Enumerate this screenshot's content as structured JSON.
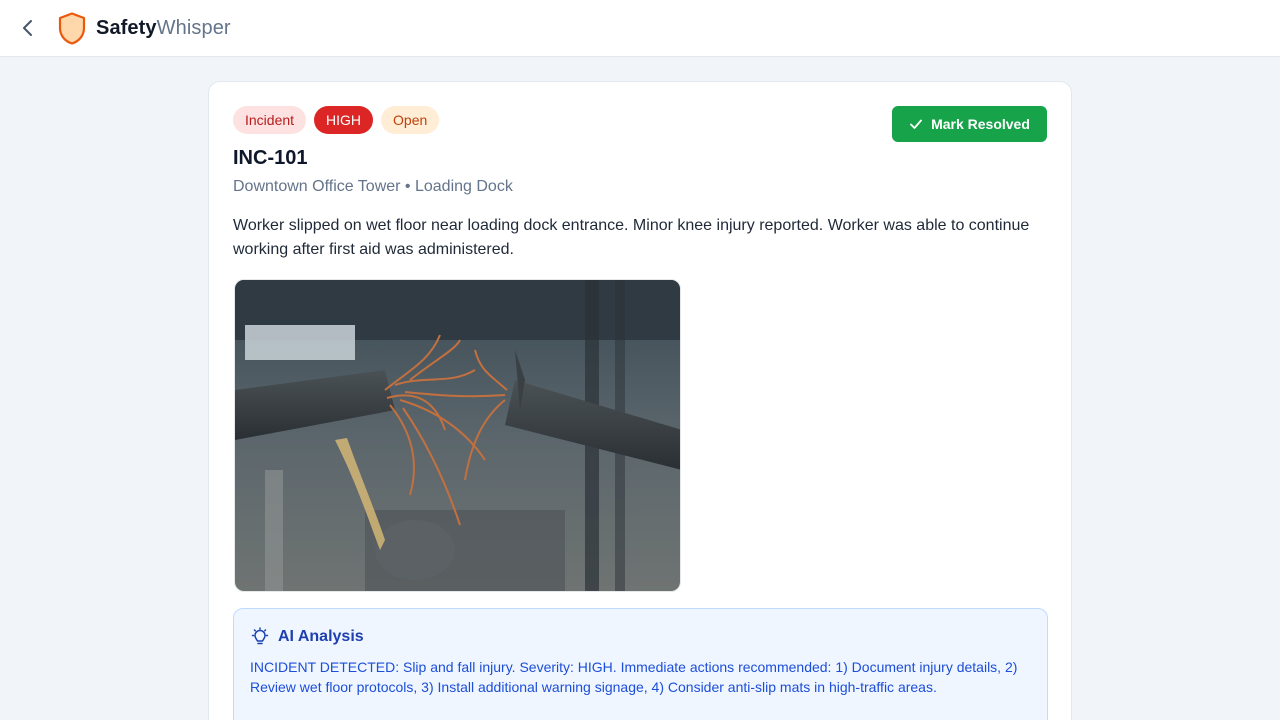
{
  "app": {
    "brand_bold": "Safety",
    "brand_light": "Whisper",
    "colors": {
      "brand_orange": "#ea580c",
      "success": "#16a34a",
      "danger": "#dc2626"
    }
  },
  "header": {
    "back_icon": "chevron-left-icon",
    "logo_icon": "shield-icon"
  },
  "incident": {
    "badges": {
      "type": "Incident",
      "severity": "HIGH",
      "status": "Open"
    },
    "resolve_button": {
      "label": "Mark Resolved",
      "icon": "check-icon"
    },
    "id": "INC-101",
    "location": "Downtown Office Tower • Loading Dock",
    "description": "Worker slipped on wet floor near loading dock entrance. Minor knee injury reported. Worker was able to continue working after first aid was administered.",
    "photo_icon": "frayed-cable-photo"
  },
  "ai_analysis": {
    "title": "AI Analysis",
    "icon": "lightbulb-icon",
    "text": "INCIDENT DETECTED: Slip and fall injury. Severity: HIGH. Immediate actions recommended: 1) Document injury details, 2) Review wet floor protocols, 3) Install additional warning signage, 4) Consider anti-slip mats in high-traffic areas."
  }
}
